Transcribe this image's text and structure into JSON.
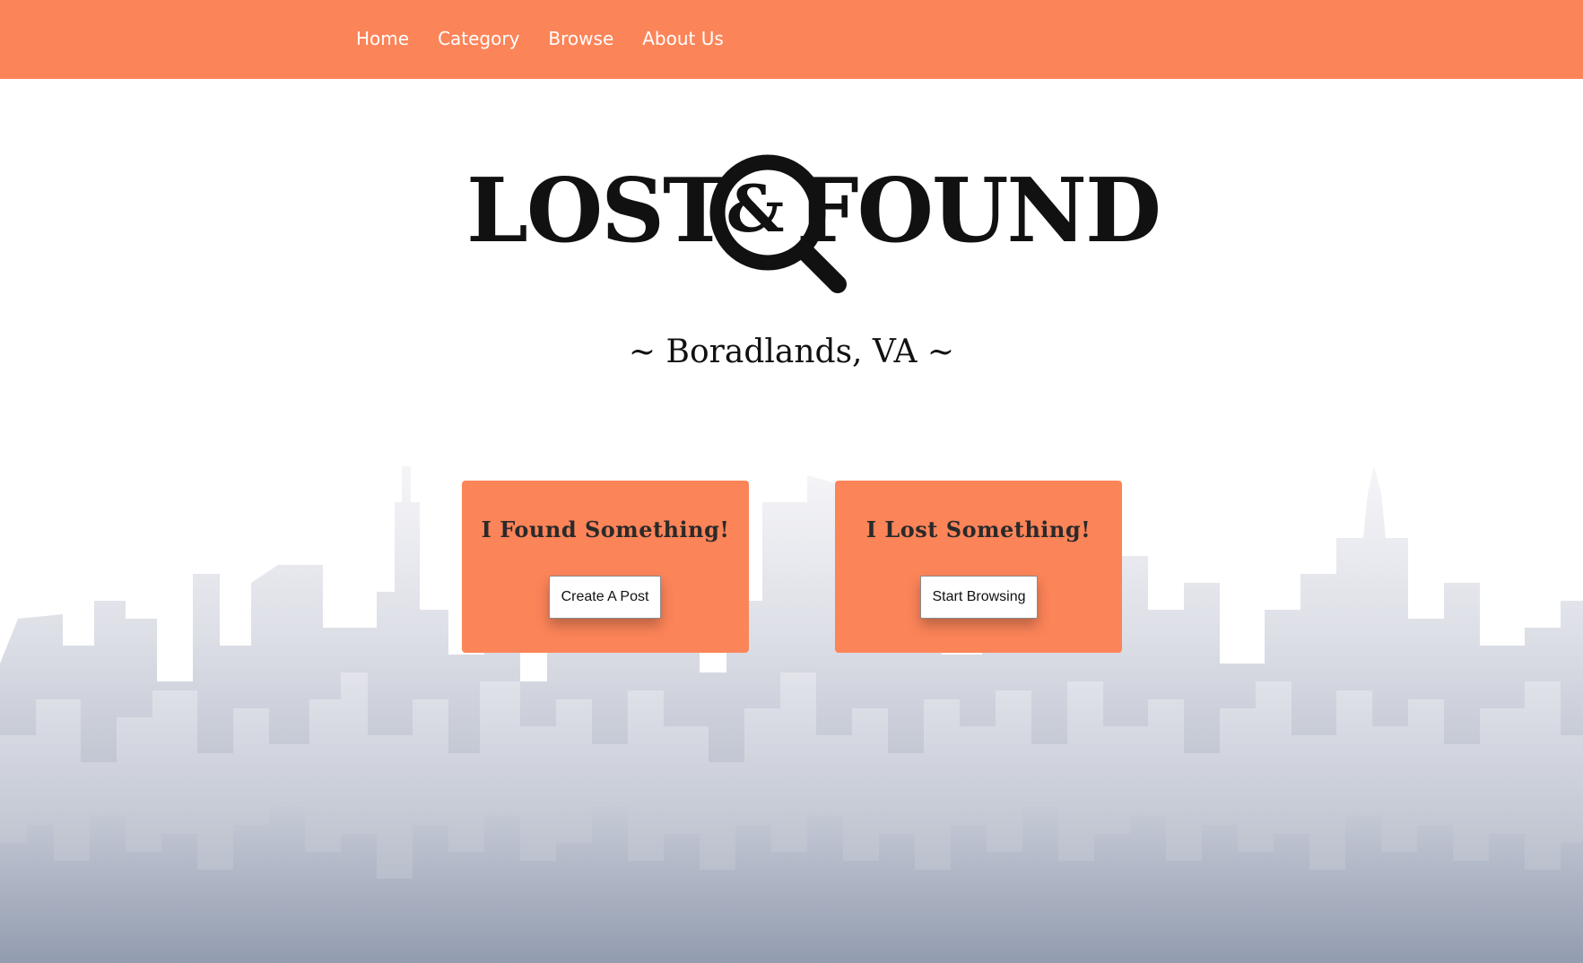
{
  "nav": {
    "items": [
      {
        "label": "Home"
      },
      {
        "label": "Category"
      },
      {
        "label": "Browse"
      },
      {
        "label": "About Us"
      }
    ]
  },
  "logo": {
    "word_left": "LOST",
    "ampersand": "&",
    "word_right": "FOUND"
  },
  "location": "~ Boradlands, VA ~",
  "cards": {
    "found": {
      "title": "I Found Something!",
      "button_label": "Create A Post"
    },
    "lost": {
      "title": "I Lost Something!",
      "button_label": "Start Browsing"
    }
  },
  "colors": {
    "accent": "#fc8459",
    "skyline_light": "#e4e6ee",
    "skyline_dark": "#9aa3b4",
    "text_dark": "#111111"
  }
}
